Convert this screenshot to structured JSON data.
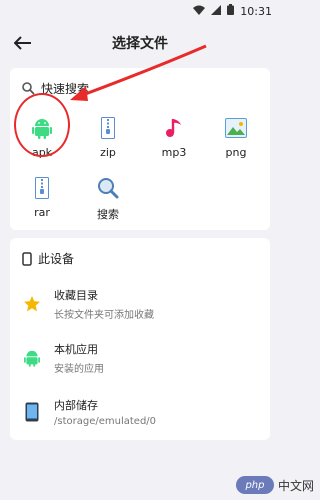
{
  "status": {
    "time": "10:31"
  },
  "header": {
    "title": "选择文件"
  },
  "quick_search": {
    "label": "快速搜索",
    "items": [
      {
        "label": "apk",
        "icon": "android-icon"
      },
      {
        "label": "zip",
        "icon": "zip-file-icon"
      },
      {
        "label": "mp3",
        "icon": "music-note-icon"
      },
      {
        "label": "png",
        "icon": "image-icon"
      },
      {
        "label": "rar",
        "icon": "rar-file-icon"
      },
      {
        "label": "搜索",
        "icon": "search-icon"
      }
    ]
  },
  "device": {
    "label": "此设备",
    "rows": [
      {
        "title": "收藏目录",
        "subtitle": "长按文件夹可添加收藏",
        "icon": "star-icon"
      },
      {
        "title": "本机应用",
        "subtitle": "安装的应用",
        "icon": "android-icon"
      },
      {
        "title": "内部储存",
        "subtitle": "/storage/emulated/0",
        "icon": "phone-storage-icon"
      }
    ]
  },
  "watermark": {
    "logo": "php",
    "text": "中文网"
  },
  "colors": {
    "android": "#3ddc84",
    "star": "#f5b800",
    "music": "#e91e63",
    "annotation": "#e82a2a"
  }
}
